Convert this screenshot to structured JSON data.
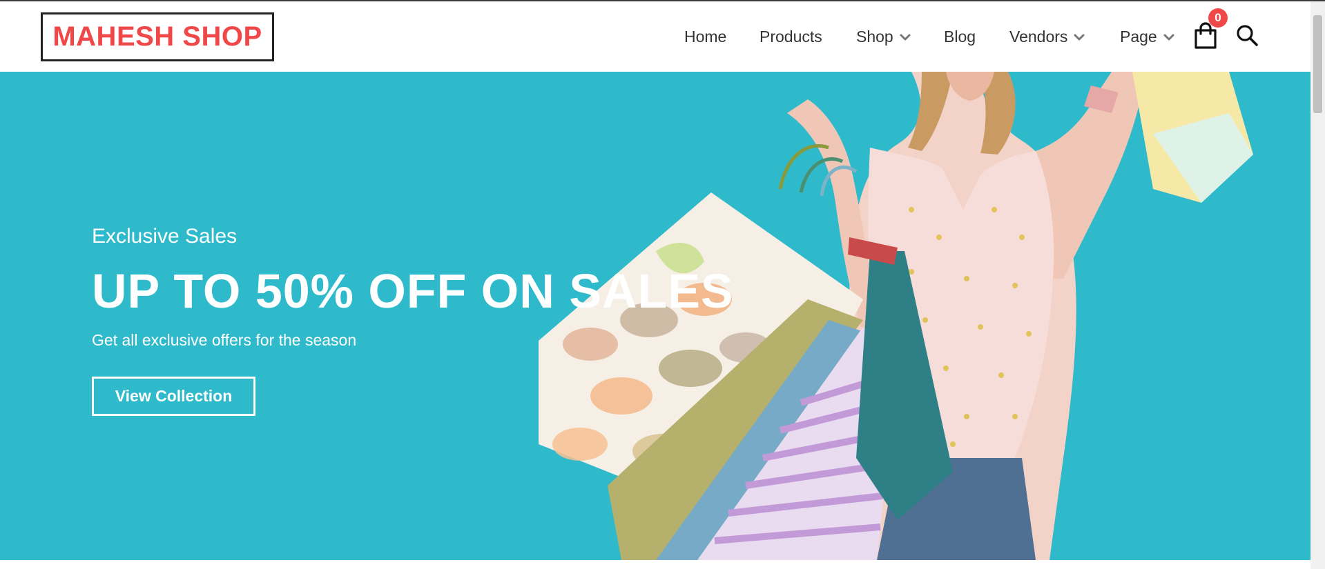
{
  "brand": {
    "logo_text": "MAHESH SHOP",
    "accent_color": "#f04848"
  },
  "nav": {
    "items": [
      {
        "label": "Home",
        "has_dropdown": false
      },
      {
        "label": "Products",
        "has_dropdown": false
      },
      {
        "label": "Shop",
        "has_dropdown": true
      },
      {
        "label": "Blog",
        "has_dropdown": false
      },
      {
        "label": "Vendors",
        "has_dropdown": true
      },
      {
        "label": "Page",
        "has_dropdown": true
      }
    ],
    "cart": {
      "icon": "shopping-bag-icon",
      "count": "0"
    },
    "search": {
      "icon": "search-icon"
    }
  },
  "hero": {
    "background_color": "#2fbacc",
    "subtitle": "Exclusive Sales",
    "title": "UP TO 50% OFF ON SALES",
    "description": "Get all exclusive offers for the season",
    "button_label": "View Collection",
    "image": "woman-with-shopping-bags"
  }
}
